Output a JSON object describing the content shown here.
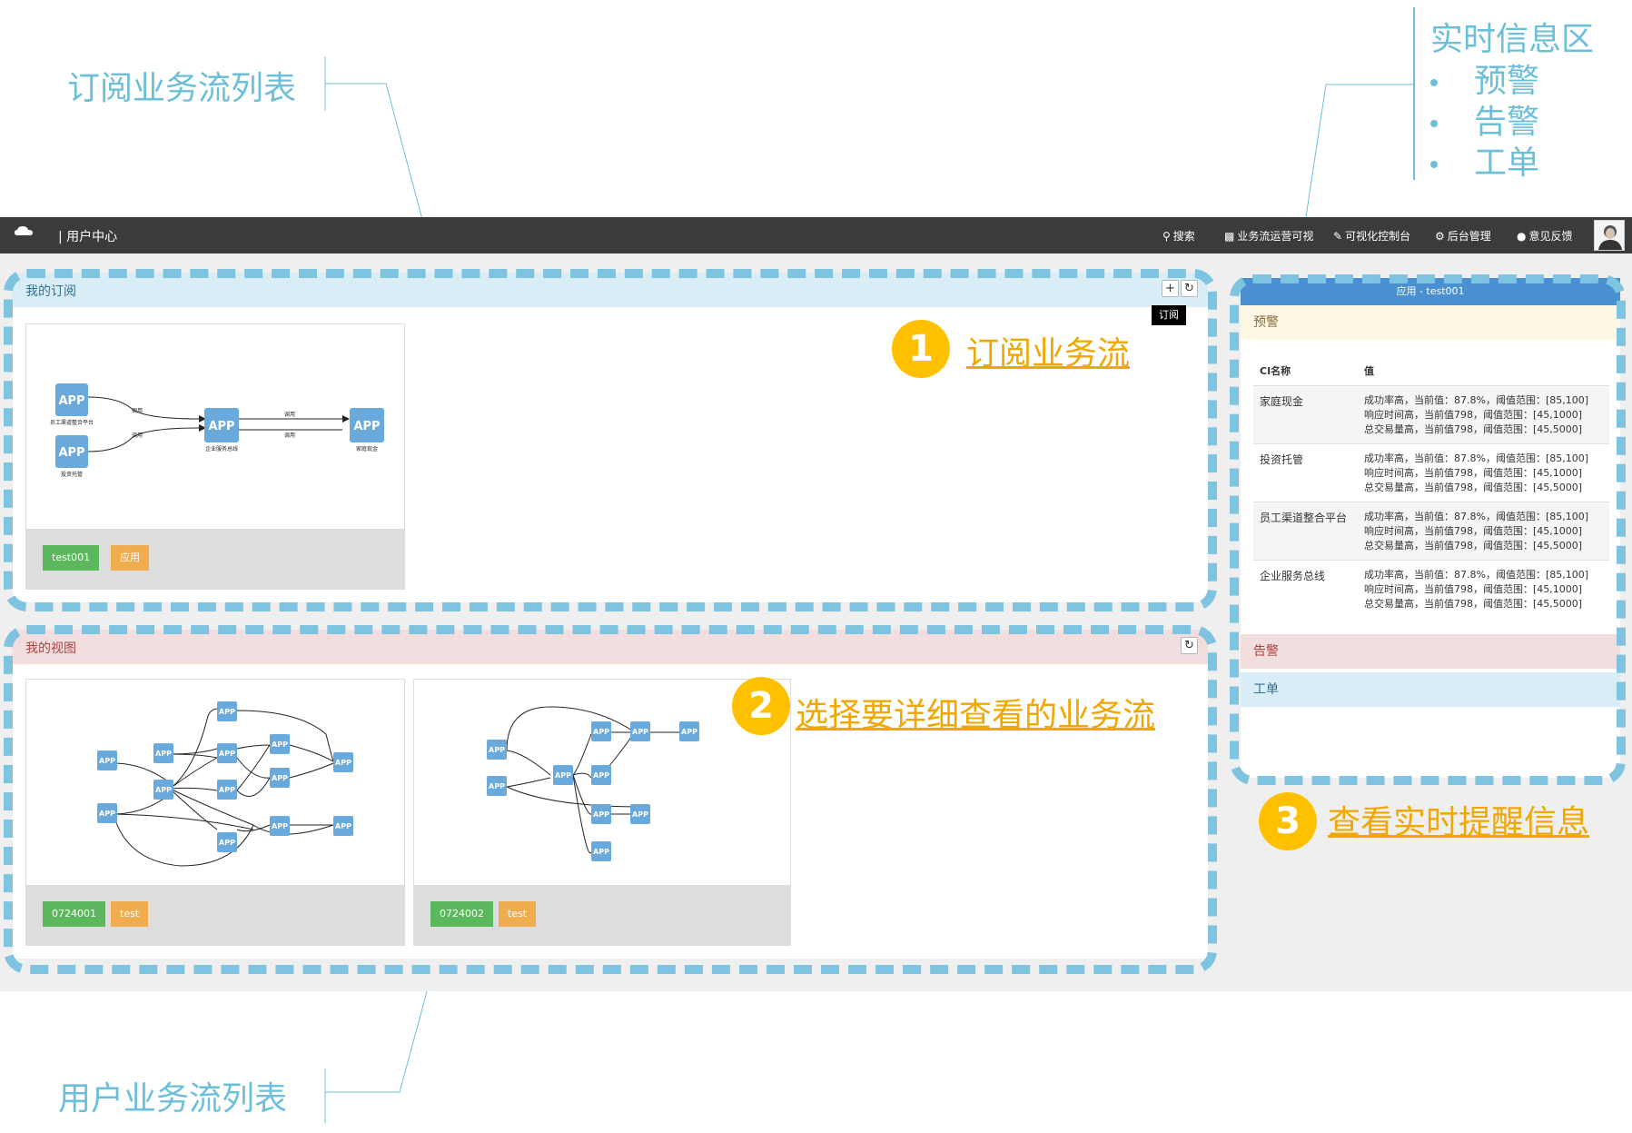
{
  "annotations": {
    "subscribe_list_label": "订阅业务流列表",
    "user_list_label": "用户业务流列表",
    "realtime_title": "实时信息区",
    "realtime_items": [
      "预警",
      "告警",
      "工单"
    ],
    "steps": [
      {
        "num": "1",
        "text": "订阅业务流"
      },
      {
        "num": "2",
        "text": "选择要详细查看的业务流"
      },
      {
        "num": "3",
        "text": "查看实时提醒信息"
      }
    ]
  },
  "navbar": {
    "brand": "| 用户中心",
    "items": [
      {
        "icon": "search-icon",
        "label": "搜索"
      },
      {
        "icon": "sitemap-icon",
        "label": "业务流运营可视"
      },
      {
        "icon": "edit-icon",
        "label": "可视化控制台"
      },
      {
        "icon": "gear-icon",
        "label": "后台管理"
      },
      {
        "icon": "comment-icon",
        "label": "意见反馈"
      }
    ]
  },
  "subscriptions": {
    "title": "我的订阅",
    "tooltip": "订阅",
    "cards": [
      {
        "tags": [
          "test001",
          "应用"
        ],
        "nodes": [
          {
            "label": "APP",
            "caption": "员工渠道整合平台"
          },
          {
            "label": "APP",
            "caption": "投资托管"
          },
          {
            "label": "APP",
            "caption": "企业服务总线"
          },
          {
            "label": "APP",
            "caption": "家庭现金"
          }
        ],
        "edge_label": "调用"
      }
    ]
  },
  "views": {
    "title": "我的视图",
    "cards": [
      {
        "tags": [
          "0724001",
          "test"
        ],
        "node_label": "APP"
      },
      {
        "tags": [
          "0724002",
          "test"
        ],
        "node_label": "APP"
      }
    ]
  },
  "realtime": {
    "header": "应用 - test001",
    "warning_title": "预警",
    "table_headers": [
      "CI名称",
      "值"
    ],
    "rows": [
      {
        "name": "家庭现金",
        "lines": [
          "成功率高，当前值：87.8%，阈值范围：[85,100]",
          "响应时间高，当前值798，阈值范围：[45,1000]",
          "总交易量高，当前值798，阈值范围：[45,5000]"
        ]
      },
      {
        "name": "投资托管",
        "lines": [
          "成功率高，当前值：87.8%，阈值范围：[85,100]",
          "响应时间高，当前值798，阈值范围：[45,1000]",
          "总交易量高，当前值798，阈值范围：[45,5000]"
        ]
      },
      {
        "name": "员工渠道整合平台",
        "lines": [
          "成功率高，当前值：87.8%，阈值范围：[85,100]",
          "响应时间高，当前值798，阈值范围：[45,1000]",
          "总交易量高，当前值798，阈值范围：[45,5000]"
        ]
      },
      {
        "name": "企业服务总线",
        "lines": [
          "成功率高，当前值：87.8%，阈值范围：[85,100]",
          "响应时间高，当前值798，阈值范围：[45,1000]",
          "总交易量高，当前值798，阈值范围：[45,5000]"
        ]
      }
    ],
    "alarm_title": "告警",
    "ticket_title": "工单"
  },
  "colors": {
    "navbar": "#3b3b3b",
    "accent_blue": "#7ec4e0",
    "step_yellow": "#ffc000",
    "tag_green": "#5cb85c",
    "tag_orange": "#f0ad4e",
    "app_node": "#6aa9dc",
    "warning_bg": "#fcf8e3",
    "alarm_bg": "#f2dede",
    "ticket_bg": "#d9edf7"
  }
}
